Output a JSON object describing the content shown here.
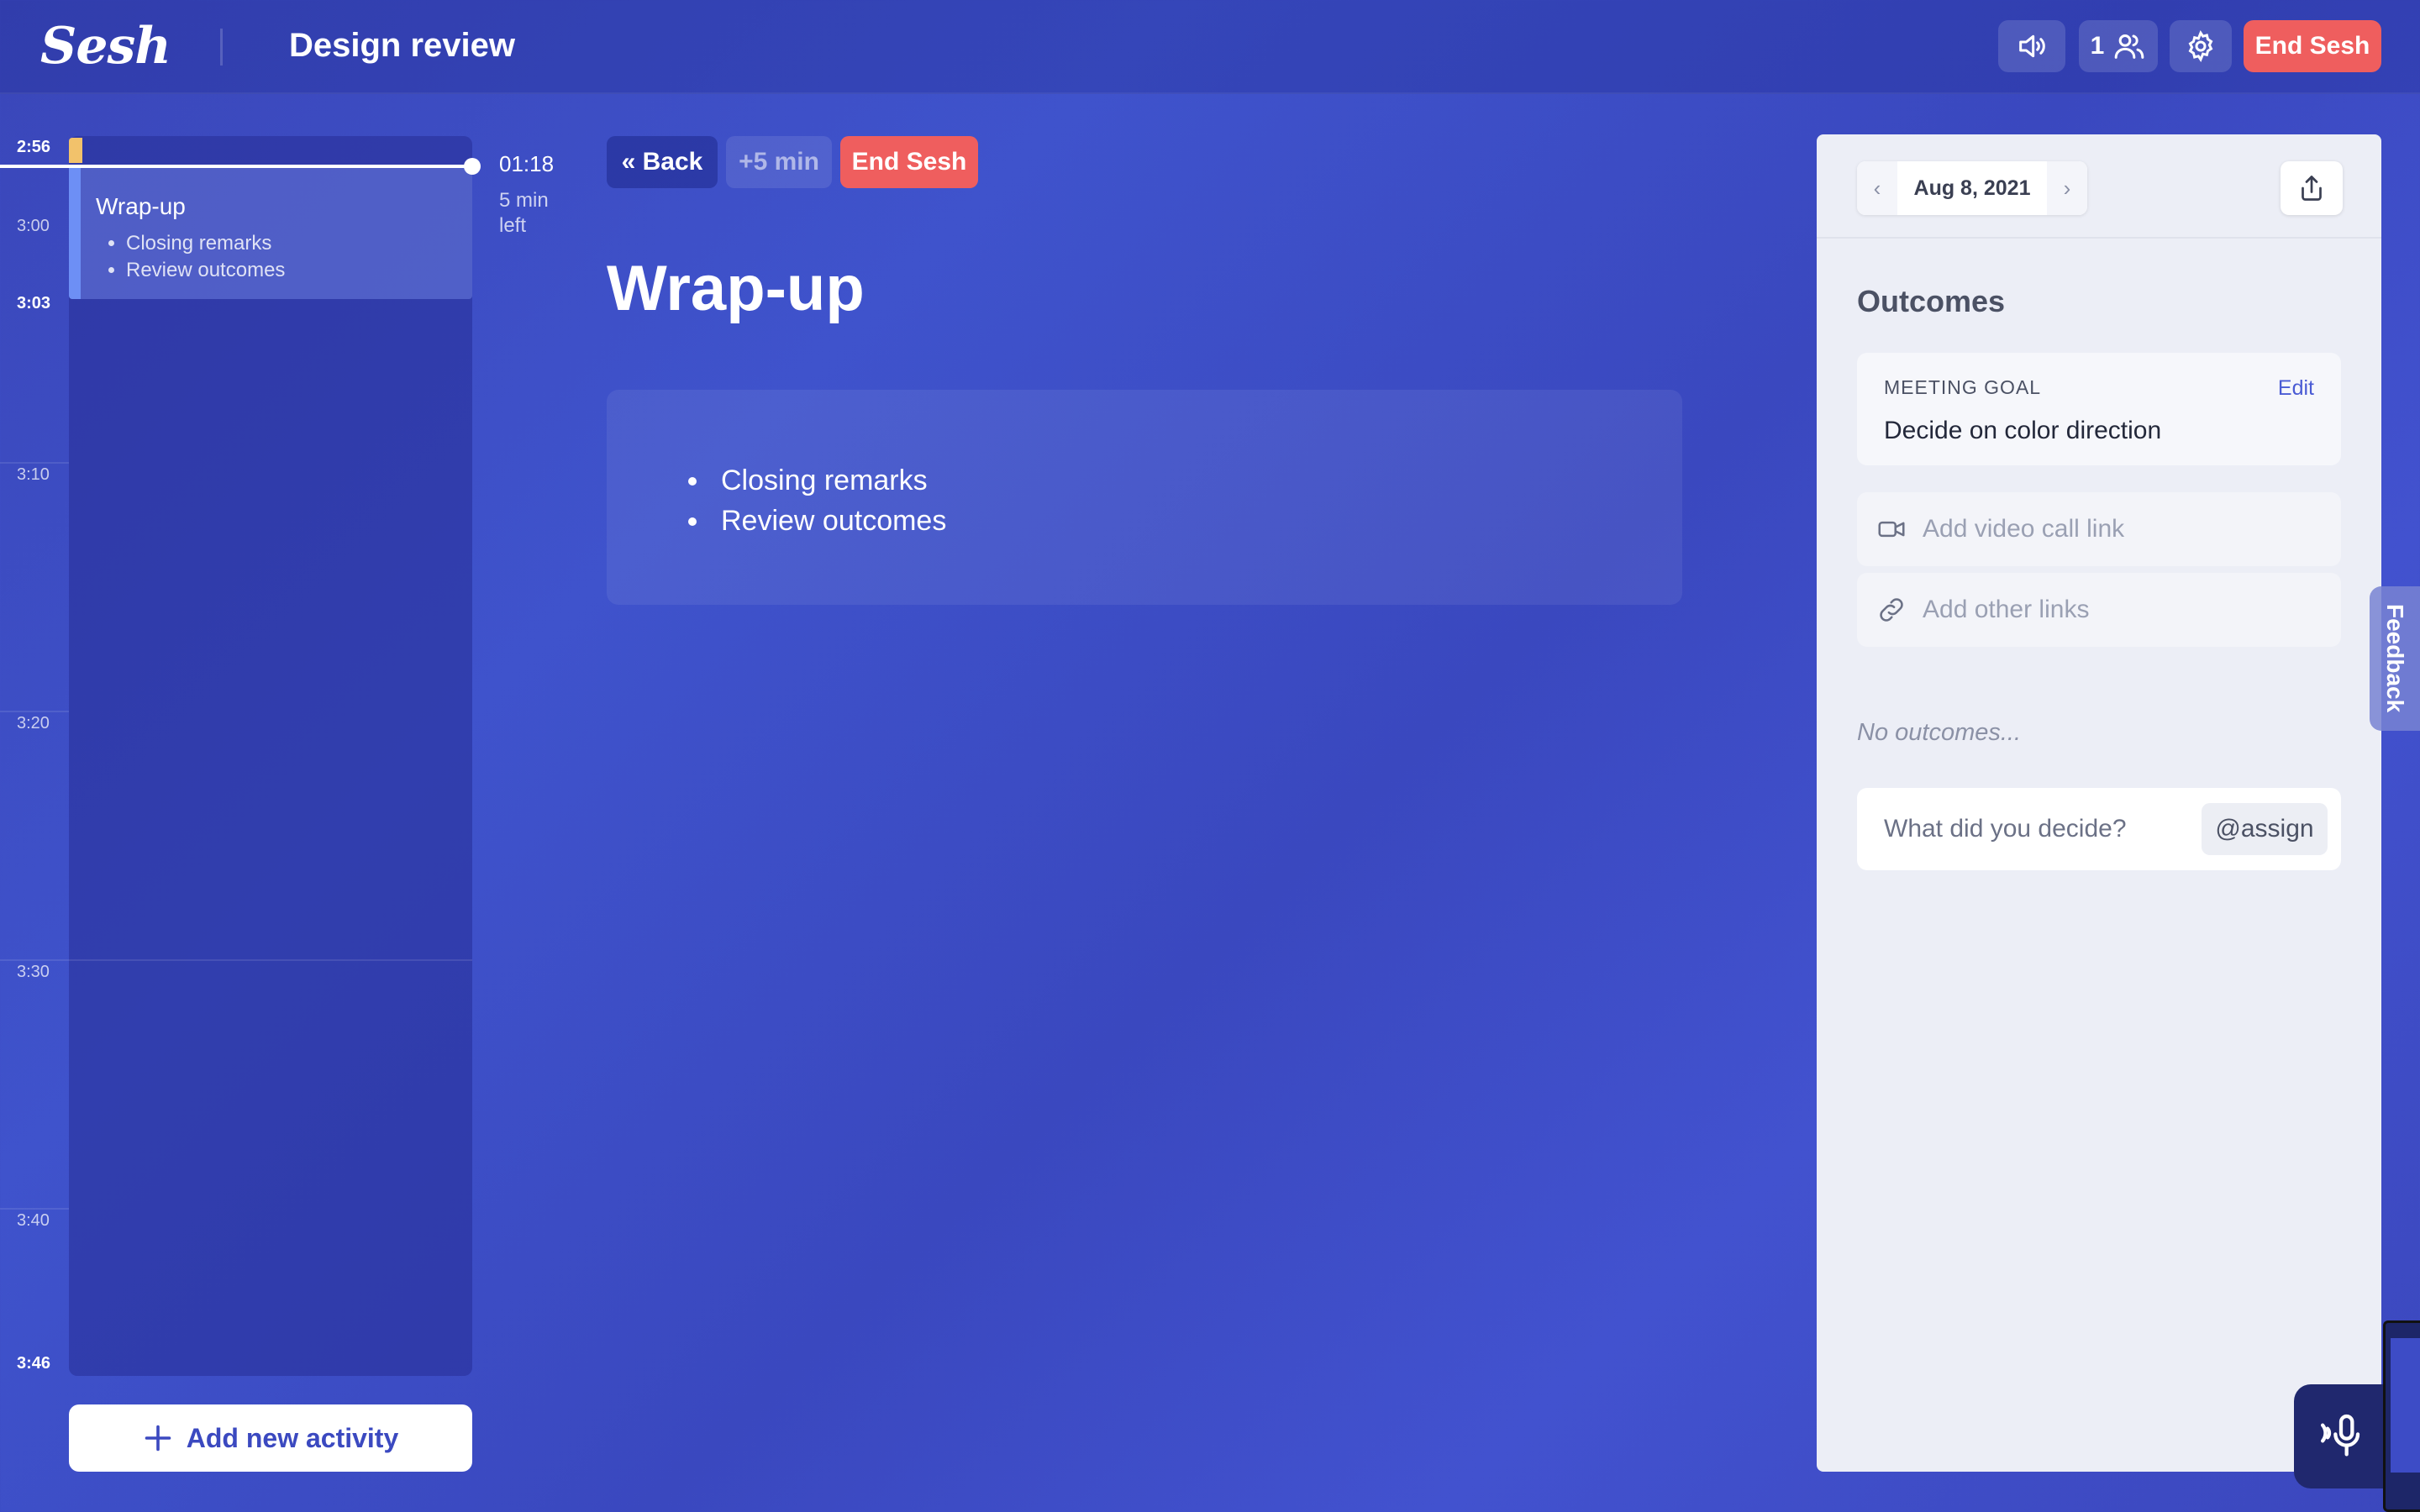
{
  "app": {
    "logo": "Sesh",
    "title": "Design review"
  },
  "header": {
    "participants_count": "1",
    "end_label": "End Sesh",
    "icons": {
      "sound": "speaker-icon",
      "people": "people-icon",
      "settings": "gear-icon"
    }
  },
  "timeline": {
    "ticks": [
      {
        "label": "2:56",
        "bold": true
      },
      {
        "label": "3:00",
        "bold": false
      },
      {
        "label": "3:03",
        "bold": true
      },
      {
        "label": "3:10",
        "bold": false
      },
      {
        "label": "3:20",
        "bold": false
      },
      {
        "label": "3:30",
        "bold": false
      },
      {
        "label": "3:40",
        "bold": false
      },
      {
        "label": "3:46",
        "bold": true
      }
    ],
    "activity": {
      "title": "Wrap-up",
      "items": [
        "Closing remarks",
        "Review outcomes"
      ]
    },
    "timer": "01:18",
    "time_left": "5 min left",
    "add_label": "Add new activity"
  },
  "main": {
    "back_label": "« Back",
    "plus_label": "+5 min",
    "end_label": "End Sesh",
    "title": "Wrap-up",
    "notes": [
      "Closing remarks",
      "Review outcomes"
    ]
  },
  "panel": {
    "date": "Aug 8, 2021",
    "outcomes_heading": "Outcomes",
    "goal_label": "MEETING GOAL",
    "goal_edit": "Edit",
    "goal_value": "Decide on color direction",
    "video_placeholder": "Add video call link",
    "links_placeholder": "Add other links",
    "no_outcomes": "No outcomes...",
    "decide_placeholder": "What did you decide?",
    "assign_label": "@assign"
  },
  "feedback_label": "Feedback",
  "colors": {
    "accent": "#3d4cc6",
    "danger": "#ef5e5e",
    "panel": "#eceef6",
    "prev_activity": "#f2c26b"
  }
}
